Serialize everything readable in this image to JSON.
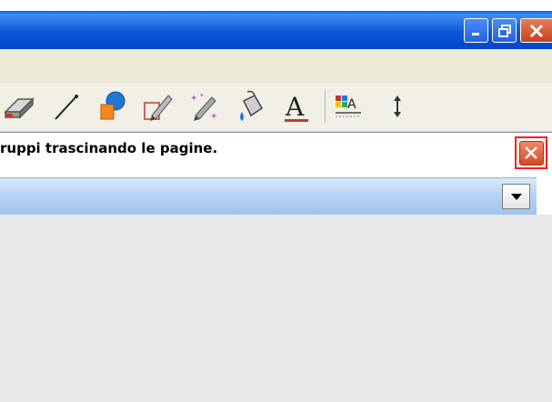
{
  "window": {
    "controls": {
      "minimize_icon": "minimize-icon",
      "maximize_icon": "restore-icon",
      "close_icon": "close-icon"
    },
    "titlebar_color": "#0b57da"
  },
  "toolbar": {
    "tools": [
      {
        "name": "eraser-icon"
      },
      {
        "name": "line-icon"
      },
      {
        "name": "shapes-icon"
      },
      {
        "name": "pencil-icon"
      },
      {
        "name": "magic-pen-icon"
      },
      {
        "name": "fill-icon"
      },
      {
        "name": "text-icon",
        "label": "A"
      },
      {
        "name": "table-icon",
        "label": "A"
      },
      {
        "name": "resize-icon",
        "label": "↕"
      }
    ]
  },
  "info": {
    "message": "ruppi trascinando le pagine."
  },
  "dropdown": {
    "value": ""
  }
}
